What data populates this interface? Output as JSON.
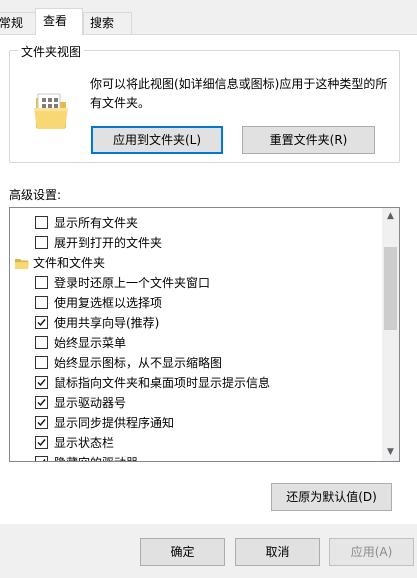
{
  "tabs": [
    {
      "label": "常规"
    },
    {
      "label": "查看"
    },
    {
      "label": "搜索"
    }
  ],
  "folder_views": {
    "title": "文件夹视图",
    "description": "你可以将此视图(如详细信息或图标)应用于这种类型的所有文件夹。",
    "apply_button": "应用到文件夹(L)",
    "reset_button": "重置文件夹(R)"
  },
  "advanced": {
    "label": "高级设置:",
    "items": [
      {
        "label": "显示所有文件夹",
        "checked": false,
        "type": "checkbox"
      },
      {
        "label": "展开到打开的文件夹",
        "checked": false,
        "type": "checkbox"
      },
      {
        "label": "文件和文件夹",
        "type": "folder"
      },
      {
        "label": "登录时还原上一个文件夹窗口",
        "checked": false,
        "type": "checkbox"
      },
      {
        "label": "使用复选框以选择项",
        "checked": false,
        "type": "checkbox"
      },
      {
        "label": "使用共享向导(推荐)",
        "checked": true,
        "type": "checkbox"
      },
      {
        "label": "始终显示菜单",
        "checked": false,
        "type": "checkbox"
      },
      {
        "label": "始终显示图标，从不显示缩略图",
        "checked": false,
        "type": "checkbox"
      },
      {
        "label": "鼠标指向文件夹和桌面项时显示提示信息",
        "checked": true,
        "type": "checkbox"
      },
      {
        "label": "显示驱动器号",
        "checked": true,
        "type": "checkbox"
      },
      {
        "label": "显示同步提供程序通知",
        "checked": true,
        "type": "checkbox"
      },
      {
        "label": "显示状态栏",
        "checked": true,
        "type": "checkbox"
      },
      {
        "label": "隐藏空的驱动器",
        "checked": true,
        "type": "checkbox"
      }
    ],
    "restore_button": "还原为默认值(D)"
  },
  "footer": {
    "ok": "确定",
    "cancel": "取消",
    "apply": "应用(A)"
  },
  "colors": {
    "accent": "#0078d7",
    "folder": "#f8d775"
  }
}
